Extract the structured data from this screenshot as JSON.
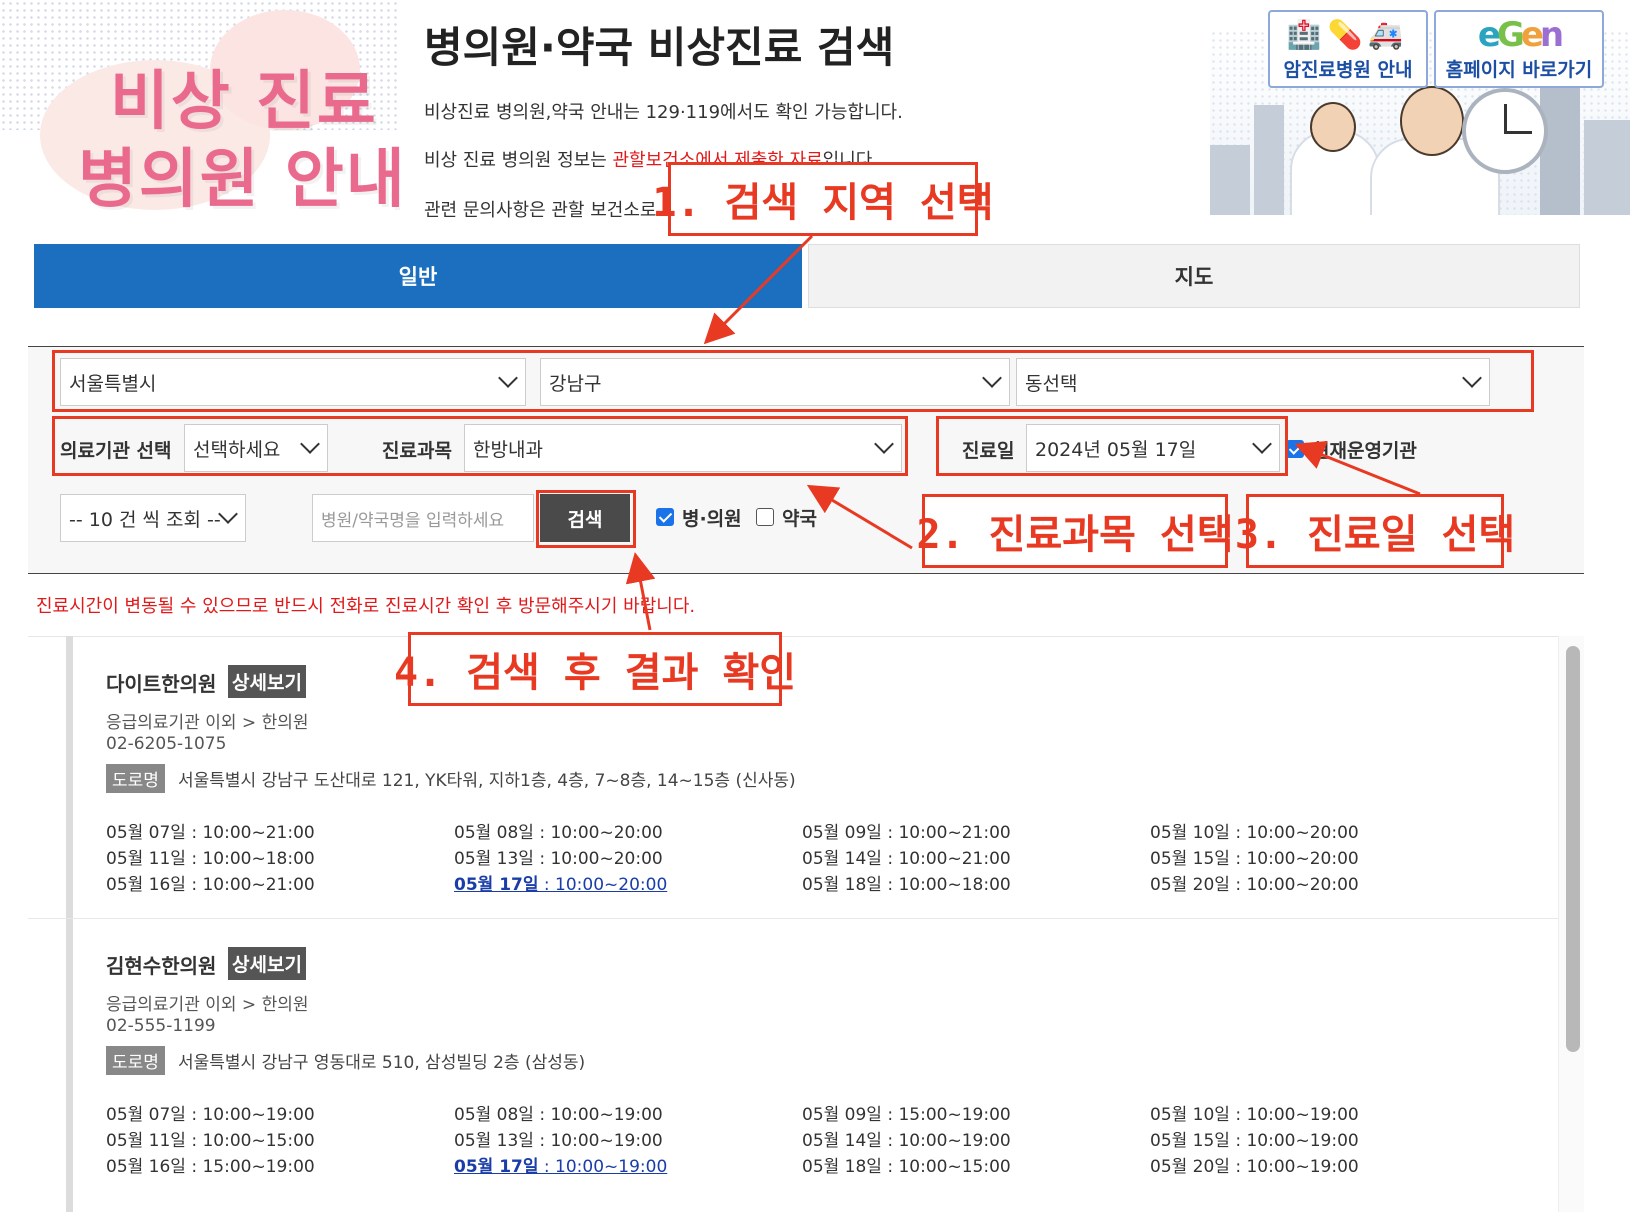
{
  "header": {
    "banner_line1": "비상 진료",
    "banner_line2": "병의원 안내",
    "title": "병의원·약국 비상진료 검색",
    "info1": "비상진료 병의원,약국 안내는 129·119에서도 확인 가능합니다.",
    "info2_prefix": "비상 진료 병의원 정보는 ",
    "info2_highlight": "관할보건소에서 제출한 자료",
    "info2_suffix": "입니다.",
    "info3": "관련 문의사항은 관할 보건소로",
    "link_cancer": "암진료병원 안내",
    "link_home": "홈페이지 바로가기"
  },
  "tabs": {
    "general": "일반",
    "map": "지도"
  },
  "search": {
    "sido": "서울특별시",
    "sigungu": "강남구",
    "dong": "동선택",
    "institution_label": "의료기관 선택",
    "institution_value": "선택하세요",
    "subject_label": "진료과목",
    "subject_value": "한방내과",
    "date_label": "진료일",
    "date_value": "2024년 05월 17일",
    "operating_label": "현재운영기관",
    "page_size": "-- 10 건 씩 조회 --",
    "name_placeholder": "병원/약국명을 입력하세요",
    "search_button": "검색",
    "check_hospital": "병·의원",
    "check_pharmacy": "약국"
  },
  "warning": "진료시간이 변동될 수 있으므로 반드시 전화로 진료시간 확인 후 방문해주시기 바랍니다.",
  "results": [
    {
      "name": "다이트한의원",
      "detail": "상세보기",
      "category": "응급의료기관 이외 > 한의원",
      "tel": "02-6205-1075",
      "road_badge": "도로명",
      "address": "서울특별시 강남구 도산대로 121, YK타워, 지하1층, 4층, 7~8층, 14~15층 (신사동)",
      "schedule": [
        [
          "05월 07일 : 10:00~21:00",
          "05월 08일 : 10:00~20:00",
          "05월 09일 : 10:00~21:00",
          "05월 10일 : 10:00~20:00"
        ],
        [
          "05월 11일 : 10:00~18:00",
          "05월 13일 : 10:00~20:00",
          "05월 14일 : 10:00~21:00",
          "05월 15일 : 10:00~20:00"
        ],
        [
          "05월 16일 : 10:00~21:00",
          "05월 17일 : 10:00~20:00",
          "05월 18일 : 10:00~18:00",
          "05월 20일 : 10:00~20:00"
        ]
      ],
      "today_date": "05월 17일",
      "today_time": " : 10:00~20:00"
    },
    {
      "name": "김현수한의원",
      "detail": "상세보기",
      "category": "응급의료기관 이외 > 한의원",
      "tel": "02-555-1199",
      "road_badge": "도로명",
      "address": "서울특별시 강남구 영동대로 510, 삼성빌딩 2층 (삼성동)",
      "schedule": [
        [
          "05월 07일 : 10:00~19:00",
          "05월 08일 : 10:00~19:00",
          "05월 09일 : 15:00~19:00",
          "05월 10일 : 10:00~19:00"
        ],
        [
          "05월 11일 : 10:00~15:00",
          "05월 13일 : 10:00~19:00",
          "05월 14일 : 10:00~19:00",
          "05월 15일 : 10:00~19:00"
        ],
        [
          "05월 16일 : 15:00~19:00",
          "05월 17일 : 10:00~19:00",
          "05월 18일 : 10:00~15:00",
          "05월 20일 : 10:00~19:00"
        ]
      ],
      "today_date": "05월 17일",
      "today_time": " : 10:00~19:00"
    }
  ],
  "annotations": {
    "step1": "1. 검색 지역 선택",
    "step2": "2. 진료과목 선택",
    "step3": "3. 진료일 선택",
    "step4": "4. 검색 후 결과 확인",
    "color": "#e83a22"
  },
  "colors": {
    "tab_active": "#1b6fbe",
    "warning": "#e01a1a",
    "search_button": "#4a4a4a"
  }
}
